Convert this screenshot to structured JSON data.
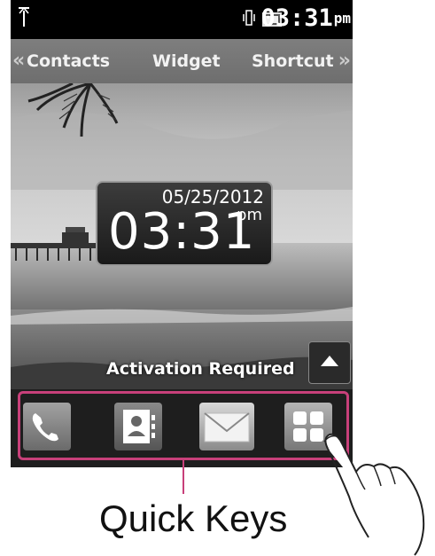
{
  "status_bar": {
    "time": "03:31",
    "ampm": "pm",
    "icons": [
      "signal-icon",
      "vibrate-icon",
      "battery-icon"
    ]
  },
  "tabs": {
    "left_arrow": "«",
    "right_arrow": "»",
    "items": [
      {
        "label": "Contacts"
      },
      {
        "label": "Widget"
      },
      {
        "label": "Shortcut"
      }
    ]
  },
  "clock_widget": {
    "date": "05/25/2012",
    "time": "03:31",
    "ampm": "pm"
  },
  "activation_text": "Activation Required",
  "quick_keys": {
    "items": [
      "phone-icon",
      "contacts-icon",
      "messages-icon",
      "menu-icon"
    ],
    "accent_color": "#c8407a"
  },
  "callout": {
    "label": "Quick Keys"
  }
}
